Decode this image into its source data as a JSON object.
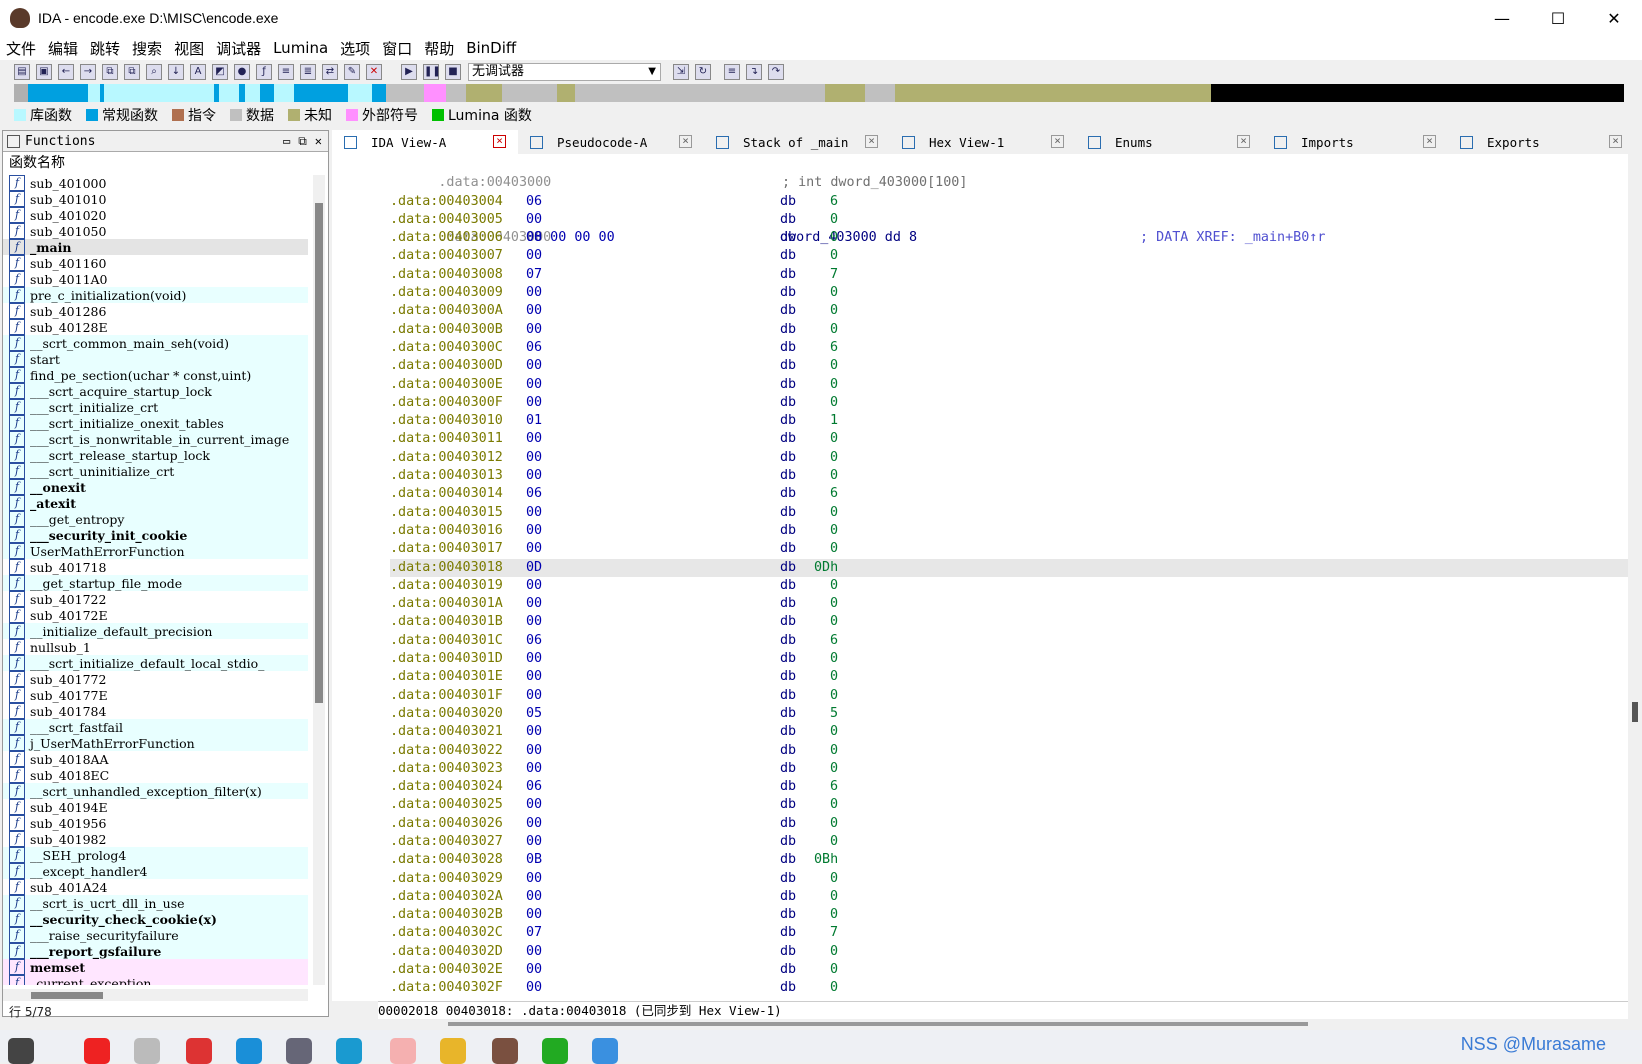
{
  "window": {
    "title": "IDA - encode.exe D:\\MISC\\encode.exe",
    "min": "—",
    "max": "☐",
    "close": "✕"
  },
  "menu": [
    "文件",
    "编辑",
    "跳转",
    "搜索",
    "视图",
    "调试器",
    "Lumina",
    "选项",
    "窗口",
    "帮助",
    "BinDiff"
  ],
  "toolbar": {
    "debugger_select": "无调试器"
  },
  "legend": [
    {
      "label": "库函数",
      "color": "#b8f8ff"
    },
    {
      "label": "常规函数",
      "color": "#00a0e0"
    },
    {
      "label": "指令",
      "color": "#b07050"
    },
    {
      "label": "数据",
      "color": "#c0c0c0"
    },
    {
      "label": "未知",
      "color": "#b0b070"
    },
    {
      "label": "外部符号",
      "color": "#ff90ff"
    },
    {
      "label": "Lumina 函数",
      "color": "#00c000"
    }
  ],
  "functions": {
    "panel_title": "Functions",
    "header": "函数名称",
    "status": "行 5/78",
    "items": [
      {
        "name": "sub_401000",
        "kind": "reg"
      },
      {
        "name": "sub_401010",
        "kind": "reg"
      },
      {
        "name": "sub_401020",
        "kind": "reg"
      },
      {
        "name": "sub_401050",
        "kind": "reg"
      },
      {
        "name": "_main",
        "kind": "sel"
      },
      {
        "name": "sub_401160",
        "kind": "reg"
      },
      {
        "name": "sub_4011A0",
        "kind": "reg"
      },
      {
        "name": "pre_c_initialization(void)",
        "kind": "lib"
      },
      {
        "name": "sub_401286",
        "kind": "reg"
      },
      {
        "name": "sub_40128E",
        "kind": "reg"
      },
      {
        "name": "__scrt_common_main_seh(void)",
        "kind": "lib"
      },
      {
        "name": "start",
        "kind": "lib"
      },
      {
        "name": "find_pe_section(uchar * const,uint)",
        "kind": "lib"
      },
      {
        "name": "___scrt_acquire_startup_lock",
        "kind": "lib"
      },
      {
        "name": "___scrt_initialize_crt",
        "kind": "lib"
      },
      {
        "name": "___scrt_initialize_onexit_tables",
        "kind": "lib"
      },
      {
        "name": "___scrt_is_nonwritable_in_current_image",
        "kind": "lib"
      },
      {
        "name": "___scrt_release_startup_lock",
        "kind": "lib"
      },
      {
        "name": "___scrt_uninitialize_crt",
        "kind": "lib"
      },
      {
        "name": "__onexit",
        "kind": "libbold"
      },
      {
        "name": "_atexit",
        "kind": "libbold"
      },
      {
        "name": "___get_entropy",
        "kind": "lib"
      },
      {
        "name": "___security_init_cookie",
        "kind": "libbold"
      },
      {
        "name": "UserMathErrorFunction",
        "kind": "lib"
      },
      {
        "name": "sub_401718",
        "kind": "reg"
      },
      {
        "name": "__get_startup_file_mode",
        "kind": "lib"
      },
      {
        "name": "sub_401722",
        "kind": "reg"
      },
      {
        "name": "sub_40172E",
        "kind": "reg"
      },
      {
        "name": "__initialize_default_precision",
        "kind": "lib"
      },
      {
        "name": "nullsub_1",
        "kind": "reg"
      },
      {
        "name": "___scrt_initialize_default_local_stdio_",
        "kind": "lib"
      },
      {
        "name": "sub_401772",
        "kind": "reg"
      },
      {
        "name": "sub_40177E",
        "kind": "reg"
      },
      {
        "name": "sub_401784",
        "kind": "reg"
      },
      {
        "name": "___scrt_fastfail",
        "kind": "lib"
      },
      {
        "name": "j_UserMathErrorFunction",
        "kind": "lib"
      },
      {
        "name": "sub_4018AA",
        "kind": "reg"
      },
      {
        "name": "sub_4018EC",
        "kind": "reg"
      },
      {
        "name": "__scrt_unhandled_exception_filter(x)",
        "kind": "lib"
      },
      {
        "name": "sub_40194E",
        "kind": "reg"
      },
      {
        "name": "sub_401956",
        "kind": "reg"
      },
      {
        "name": "sub_401982",
        "kind": "reg"
      },
      {
        "name": "__SEH_prolog4",
        "kind": "lib"
      },
      {
        "name": "__except_handler4",
        "kind": "lib"
      },
      {
        "name": "sub_401A24",
        "kind": "reg"
      },
      {
        "name": "__scrt_is_ucrt_dll_in_use",
        "kind": "lib"
      },
      {
        "name": "__security_check_cookie(x)",
        "kind": "libbold"
      },
      {
        "name": "___raise_securityfailure",
        "kind": "lib"
      },
      {
        "name": "___report_gsfailure",
        "kind": "libbold"
      },
      {
        "name": "memset",
        "kind": "extbold"
      },
      {
        "name": "_current_exception",
        "kind": "ext"
      }
    ]
  },
  "tabs": [
    {
      "label": "IDA View-A",
      "active": true
    },
    {
      "label": "Pseudocode-A",
      "active": false
    },
    {
      "label": "Stack of _main",
      "active": false
    },
    {
      "label": "Hex View-1",
      "active": false
    },
    {
      "label": "Enums",
      "active": false
    },
    {
      "label": "Imports",
      "active": false
    },
    {
      "label": "Exports",
      "active": false
    }
  ],
  "listing": {
    "first_line": {
      "addr": ".data:00403000",
      "comment": "; int dword_403000[100]"
    },
    "label_line": {
      "addr": ".data:00403000",
      "bytes": "08 00 00 00",
      "label": "dword_403000 dd 8",
      "xref": "; DATA XREF: _main+B0↑r"
    },
    "rows": [
      [
        "00403004",
        "06",
        "6"
      ],
      [
        "00403005",
        "00",
        "0"
      ],
      [
        "00403006",
        "00",
        "0"
      ],
      [
        "00403007",
        "00",
        "0"
      ],
      [
        "00403008",
        "07",
        "7"
      ],
      [
        "00403009",
        "00",
        "0"
      ],
      [
        "0040300A",
        "00",
        "0"
      ],
      [
        "0040300B",
        "00",
        "0"
      ],
      [
        "0040300C",
        "06",
        "6"
      ],
      [
        "0040300D",
        "00",
        "0"
      ],
      [
        "0040300E",
        "00",
        "0"
      ],
      [
        "0040300F",
        "00",
        "0"
      ],
      [
        "00403010",
        "01",
        "1"
      ],
      [
        "00403011",
        "00",
        "0"
      ],
      [
        "00403012",
        "00",
        "0"
      ],
      [
        "00403013",
        "00",
        "0"
      ],
      [
        "00403014",
        "06",
        "6"
      ],
      [
        "00403015",
        "00",
        "0"
      ],
      [
        "00403016",
        "00",
        "0"
      ],
      [
        "00403017",
        "00",
        "0"
      ],
      [
        "00403018",
        "0D",
        "0Dh"
      ],
      [
        "00403019",
        "00",
        "0"
      ],
      [
        "0040301A",
        "00",
        "0"
      ],
      [
        "0040301B",
        "00",
        "0"
      ],
      [
        "0040301C",
        "06",
        "6"
      ],
      [
        "0040301D",
        "00",
        "0"
      ],
      [
        "0040301E",
        "00",
        "0"
      ],
      [
        "0040301F",
        "00",
        "0"
      ],
      [
        "00403020",
        "05",
        "5"
      ],
      [
        "00403021",
        "00",
        "0"
      ],
      [
        "00403022",
        "00",
        "0"
      ],
      [
        "00403023",
        "00",
        "0"
      ],
      [
        "00403024",
        "06",
        "6"
      ],
      [
        "00403025",
        "00",
        "0"
      ],
      [
        "00403026",
        "00",
        "0"
      ],
      [
        "00403027",
        "00",
        "0"
      ],
      [
        "00403028",
        "0B",
        "0Bh"
      ],
      [
        "00403029",
        "00",
        "0"
      ],
      [
        "0040302A",
        "00",
        "0"
      ],
      [
        "0040302B",
        "00",
        "0"
      ],
      [
        "0040302C",
        "07",
        "7"
      ],
      [
        "0040302D",
        "00",
        "0"
      ],
      [
        "0040302E",
        "00",
        "0"
      ],
      [
        "0040302F",
        "00",
        "0"
      ]
    ],
    "segment_prefix": ".data:",
    "mnemonic": "db",
    "highlight_addr": "00403018"
  },
  "status_line": "00002018 00403018: .data:00403018 (已同步到 Hex View-1)",
  "watermark": "NSS @Murasame"
}
